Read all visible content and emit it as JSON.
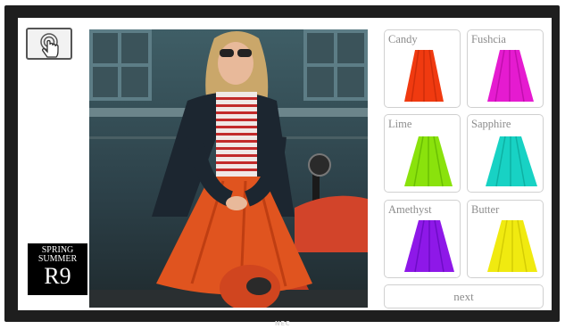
{
  "brand": "NEC",
  "season": {
    "line1": "SPRING",
    "line2": "SUMMER",
    "code": "R9"
  },
  "swatches": [
    {
      "label": "Candy",
      "color": "#f03a10",
      "shade": "#c02808"
    },
    {
      "label": "Fushcia",
      "color": "#e51bd0",
      "shade": "#b20aa0"
    },
    {
      "label": "Lime",
      "color": "#8ae20c",
      "shade": "#5cb000"
    },
    {
      "label": "Sapphire",
      "color": "#18d2c4",
      "shade": "#0aa396"
    },
    {
      "label": "Amethyst",
      "color": "#8e18e8",
      "shade": "#6008b8"
    },
    {
      "label": "Butter",
      "color": "#f0ea10",
      "shade": "#c8c000"
    }
  ],
  "next_label": "next",
  "icons": {
    "touch": "hand-pointer-icon"
  }
}
